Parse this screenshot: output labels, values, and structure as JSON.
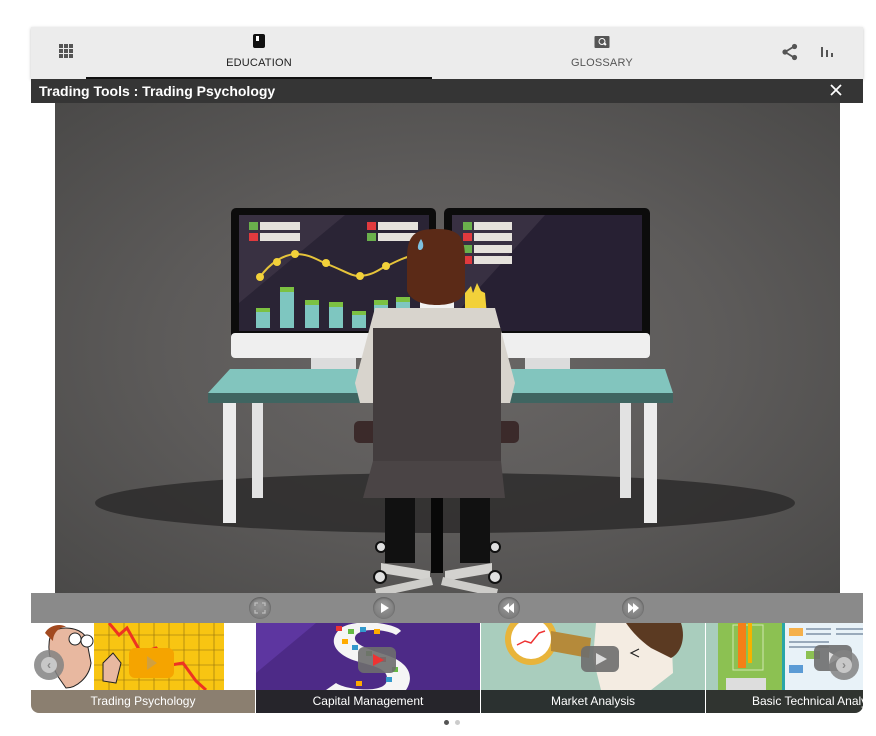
{
  "nav": {
    "menu_icon": "apps-grid-icon",
    "tabs": [
      {
        "label": "EDUCATION",
        "icon": "book-icon",
        "active": true
      },
      {
        "label": "GLOSSARY",
        "icon": "glossary-search-icon",
        "active": false
      }
    ],
    "share_icon": "share-icon",
    "chart_icon": "bar-chart-icon"
  },
  "titlebar": {
    "title": "Trading Tools : Trading Psychology",
    "close_icon": "close-icon"
  },
  "video": {
    "subject": "Trader at desk with two monitors",
    "controls": [
      {
        "name": "fullscreen",
        "icon": "fullscreen-icon"
      },
      {
        "name": "play",
        "icon": "play-icon"
      },
      {
        "name": "rewind",
        "icon": "rewind-icon"
      },
      {
        "name": "fast-forward",
        "icon": "fast-forward-icon"
      }
    ]
  },
  "carousel": {
    "items": [
      {
        "title": "Trading Psychology",
        "active": true
      },
      {
        "title": "Capital Management",
        "active": false
      },
      {
        "title": "Market Analysis",
        "active": false
      },
      {
        "title": "Basic Technical Analysis",
        "active": false
      }
    ],
    "prev_icon": "chevron-left-icon",
    "next_icon": "chevron-right-icon",
    "page_count": 2,
    "current_page": 1
  },
  "colors": {
    "topbar_bg": "#ececec",
    "titlebar_bg": "#353535",
    "controls_bg": "#8a8a8a",
    "active_caption_bg": "#8b7f70",
    "dot_active": "#555555",
    "dot_inactive": "#cccccc"
  }
}
